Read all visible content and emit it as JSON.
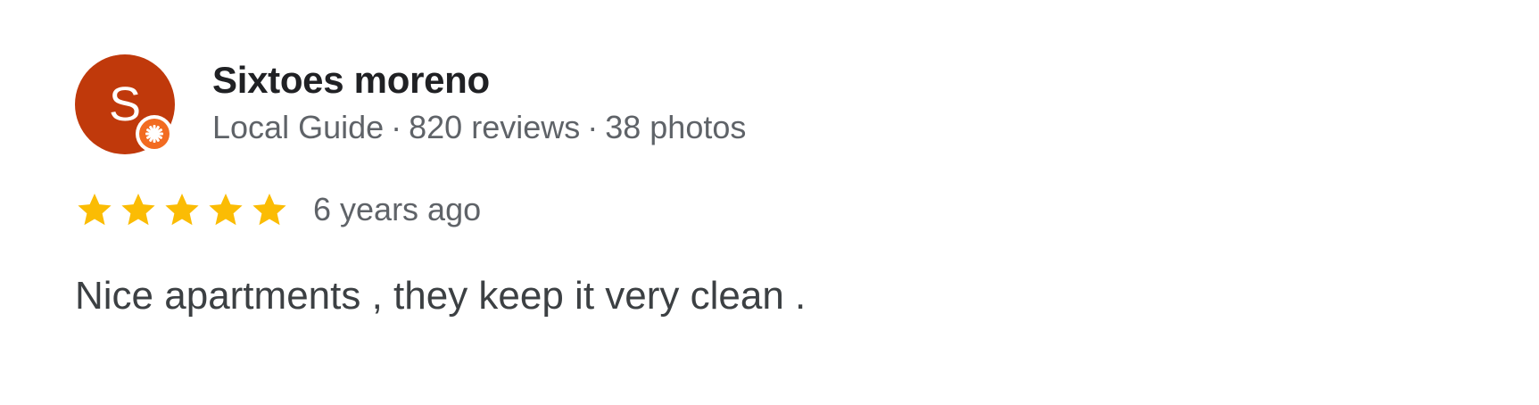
{
  "review": {
    "author": {
      "initial": "S",
      "name": "Sixtoes moreno",
      "badge": "Local Guide",
      "reviews_count": "820 reviews",
      "photos_count": "38 photos",
      "avatar_color": "#c0390b",
      "badge_color": "#f26b21",
      "badge_icon": "local-guide-star-icon"
    },
    "rating": {
      "stars": 5,
      "max_stars": 5,
      "star_color": "#fbbc04"
    },
    "date": "6 years ago",
    "text": "Nice apartments , they keep it very clean ."
  },
  "separator": "·"
}
